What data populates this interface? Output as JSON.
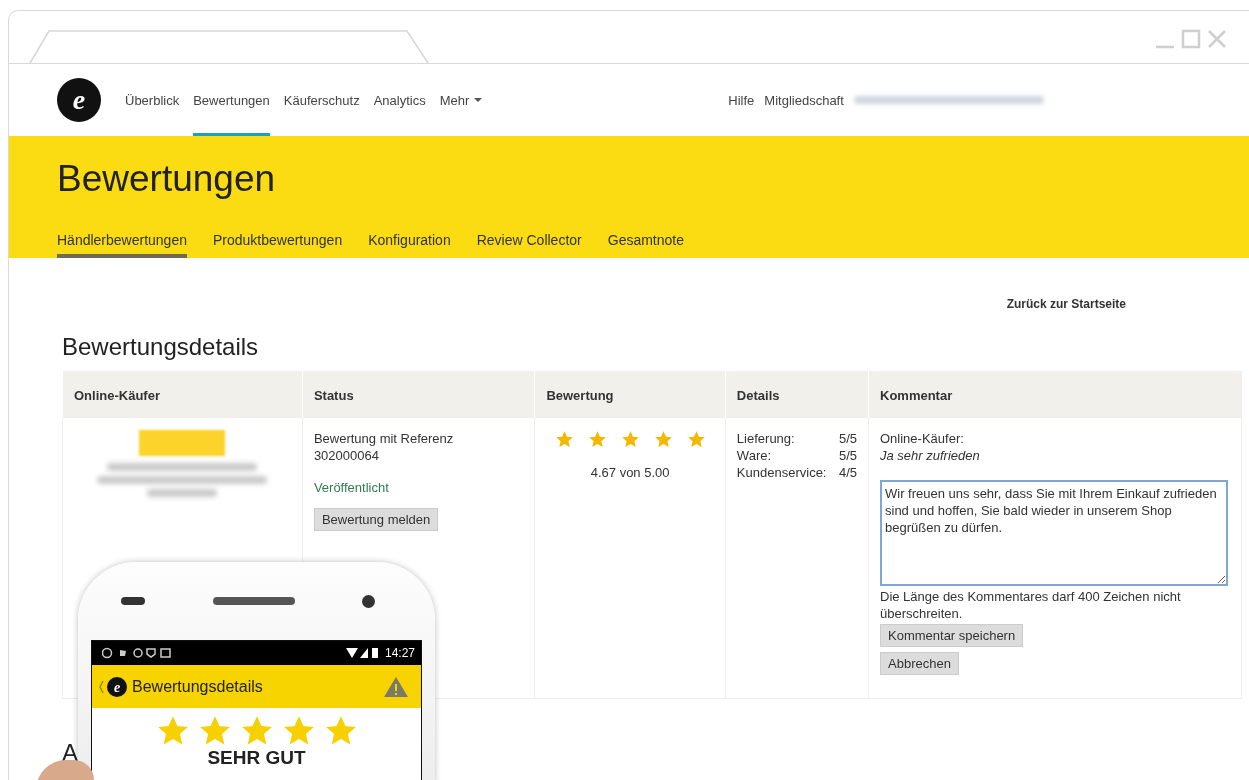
{
  "nav": {
    "logo": "e",
    "items": [
      {
        "label": "Überblick",
        "selected": false
      },
      {
        "label": "Bewertungen",
        "selected": true
      },
      {
        "label": "Käuferschutz",
        "selected": false
      },
      {
        "label": "Analytics",
        "selected": false
      },
      {
        "label": "Mehr",
        "selected": false,
        "kind": "dropdown"
      }
    ],
    "right": [
      {
        "label": "Hilfe",
        "kind": "link"
      },
      {
        "label": "Mitgliedschaft",
        "kind": "link"
      },
      {
        "kind": "blurred-account"
      }
    ]
  },
  "banner": {
    "title": "Bewertungen",
    "tabs": [
      {
        "label": "Händlerbewertungen",
        "selected": true
      },
      {
        "label": "Produktbewertungen",
        "selected": false
      },
      {
        "label": "Konfiguration",
        "selected": false
      },
      {
        "label": "Review Collector",
        "selected": false
      },
      {
        "label": "Gesamtnote",
        "selected": false
      }
    ]
  },
  "back_link": "Zurück zur Startseite",
  "section_title": "Bewertungsdetails",
  "table": {
    "columns": [
      "Online-Käufer",
      "Status",
      "Bewertung",
      "Details",
      "Kommentar"
    ],
    "rows": [
      {
        "status_text": "Bewertung mit Referenz 302000064",
        "status": "Veröffentlicht",
        "report_button": "Bewertung melden",
        "stars": 5,
        "score": "4.67 von 5.00",
        "details": [
          {
            "label": "Lieferung:",
            "value": "5/5"
          },
          {
            "label": "Ware:",
            "value": "5/5"
          },
          {
            "label": "Kundenservice:",
            "value": "4/5"
          }
        ],
        "comment_author": "Online-Käufer:",
        "comment": "Ja sehr zufrieden",
        "reply": "Wir freuen uns sehr, dass Sie mit Ihrem Einkauf zufrieden sind und hoffen, Sie bald wieder in unserem Shop begrüßen zu dürfen.",
        "hint": "Die Länge des Kommentares darf 400 Zeichen nicht überschreiten.",
        "buttons": [
          "Kommentar speichern",
          "Abbrechen"
        ]
      }
    ]
  },
  "next_heading": "A",
  "phone": {
    "logo": "e",
    "time": "14:27",
    "title": "Bewertungsdetails",
    "stars": 5,
    "verdict": "SEHR GUT"
  }
}
